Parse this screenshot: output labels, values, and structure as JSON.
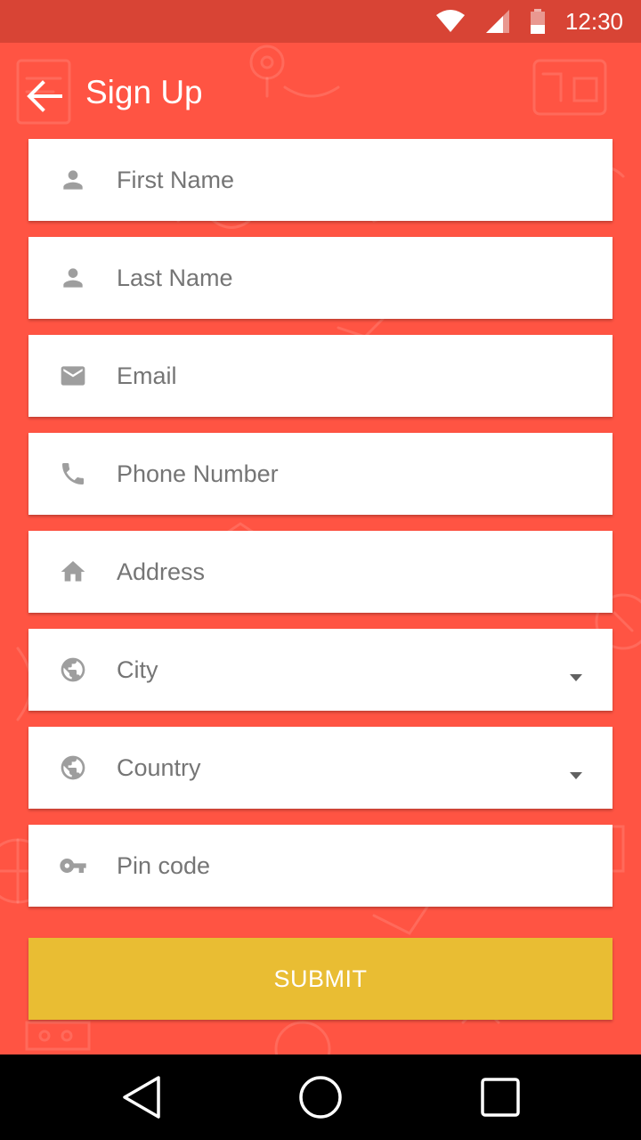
{
  "status_bar": {
    "time": "12:30",
    "icons": [
      "wifi-icon",
      "signal-icon",
      "battery-icon"
    ]
  },
  "app_bar": {
    "title": "Sign Up",
    "back_icon": "arrow-back-icon"
  },
  "form": {
    "fields": [
      {
        "placeholder": "First Name",
        "icon": "person-icon"
      },
      {
        "placeholder": "Last Name",
        "icon": "person-icon"
      },
      {
        "placeholder": "Email",
        "icon": "mail-icon"
      },
      {
        "placeholder": "Phone Number",
        "icon": "phone-icon"
      },
      {
        "placeholder": "Address",
        "icon": "home-icon"
      },
      {
        "placeholder": "City",
        "icon": "globe-icon",
        "dropdown": true
      },
      {
        "placeholder": "Country",
        "icon": "globe-icon",
        "dropdown": true
      },
      {
        "placeholder": "Pin code",
        "icon": "key-icon"
      }
    ],
    "submit_label": "SUBMIT"
  },
  "nav_bar": {
    "icons": [
      "nav-back-icon",
      "nav-home-icon",
      "nav-recents-icon"
    ]
  },
  "colors": {
    "background": "#FF5443",
    "status_bar": "#D84435",
    "field_background": "#FFFFFF",
    "placeholder_text": "#757575",
    "icon_gray": "#9E9E9E",
    "submit_button": "#E9BD33",
    "nav_bar": "#000000"
  }
}
